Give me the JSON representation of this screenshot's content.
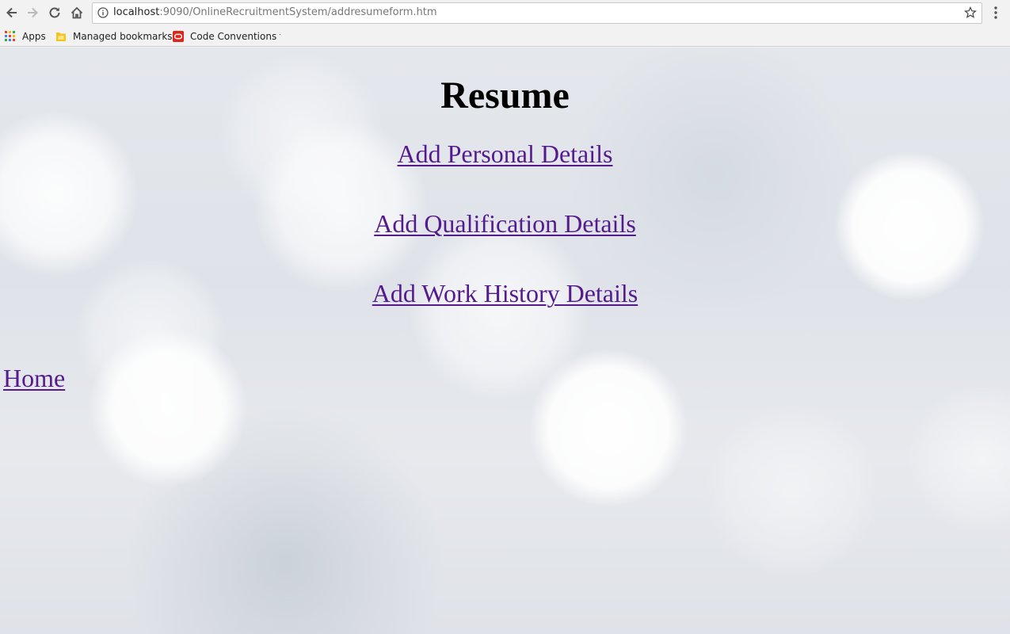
{
  "browser": {
    "url_host": "localhost",
    "url_rest": ":9090/OnlineRecruitmentSystem/addresumeform.htm",
    "bookmarks": [
      {
        "label": "Apps",
        "icon": "apps-grid-icon"
      },
      {
        "label": "Managed bookmarks",
        "icon": "folder-icon"
      },
      {
        "label": "Code Conventions fo",
        "icon": "oracle-icon"
      }
    ]
  },
  "page": {
    "title": "Resume",
    "links": [
      {
        "label": "Add Personal Details"
      },
      {
        "label": "Add Qualification Details"
      },
      {
        "label": "Add Work History Details"
      }
    ],
    "home_label": "Home"
  },
  "colors": {
    "link": "#551a8b",
    "heading": "#000000"
  }
}
